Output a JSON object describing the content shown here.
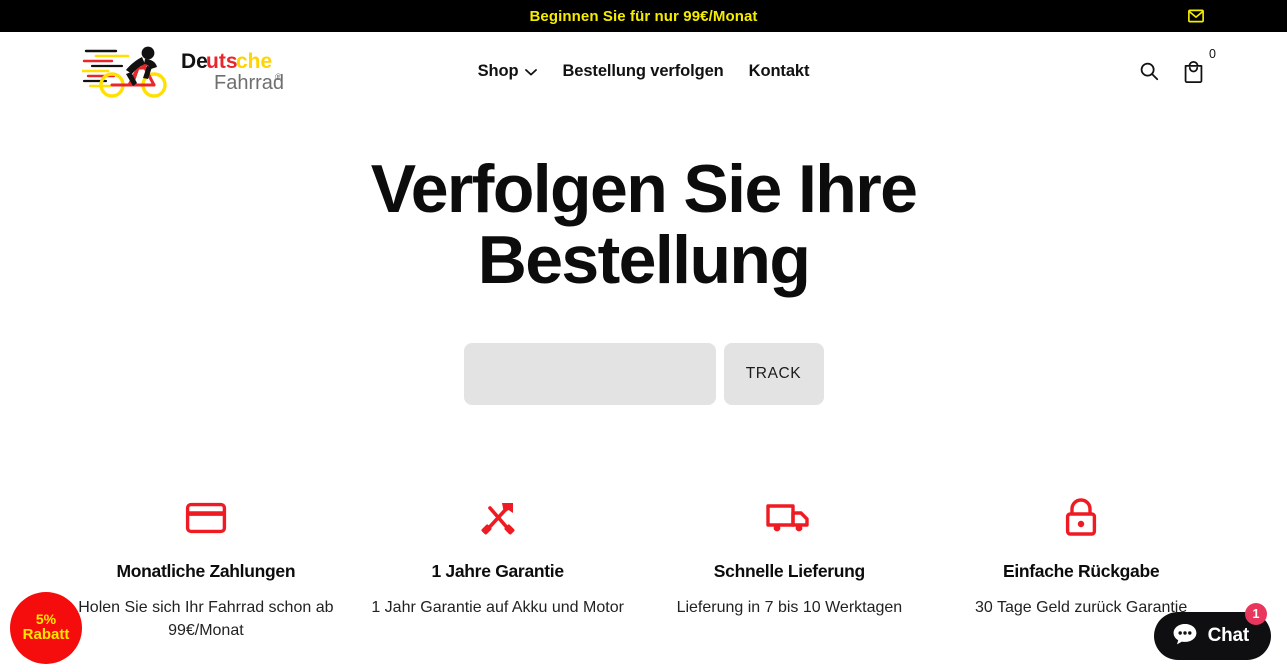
{
  "announcement": {
    "text": "Beginnen Sie für nur 99€/Monat",
    "mail_icon": "mail-icon",
    "text_color": "#f5ec00",
    "background": "#000000"
  },
  "header": {
    "logo": {
      "icon": "cyclist-icon",
      "word_primary": "Deutsche",
      "word_secondary": "Fahrrad",
      "trademark": "®",
      "colors": {
        "black": "#111111",
        "red": "#e8262c",
        "yellow": "#ffe000",
        "gray": "#6f6f6f"
      }
    },
    "nav": [
      {
        "label": "Shop",
        "has_dropdown": true,
        "icon": "chevron-down-icon"
      },
      {
        "label": "Bestellung verfolgen",
        "has_dropdown": false
      },
      {
        "label": "Kontakt",
        "has_dropdown": false
      }
    ],
    "actions": {
      "search_icon": "search-icon",
      "cart_icon": "shopping-bag-icon",
      "cart_count": "0"
    }
  },
  "hero": {
    "title_line1": "Verfolgen Sie Ihre",
    "title_line2": "Bestellung"
  },
  "track_form": {
    "input_value": "",
    "input_placeholder": "",
    "button_label": "TRACK",
    "field_background": "#e3e3e3"
  },
  "features": [
    {
      "icon": "credit-card-icon",
      "title": "Monatliche Zahlungen",
      "description": "Holen Sie sich Ihr Fahrrad schon ab 99€/Monat"
    },
    {
      "icon": "tools-icon",
      "title": "1 Jahre Garantie",
      "description": "1 Jahr Garantie auf Akku und Motor"
    },
    {
      "icon": "delivery-truck-icon",
      "title": "Schnelle Lieferung",
      "description": "Lieferung in 7 bis 10 Werktagen"
    },
    {
      "icon": "lock-icon",
      "title": "Einfache Rückgabe",
      "description": "30 Tage Geld zurück Garantie"
    }
  ],
  "feature_icon_color": "#ee1b22",
  "discount_badge": {
    "percent": "5%",
    "label": "Rabatt",
    "background": "#f50d0d",
    "text_color": "#ffe800"
  },
  "chat_widget": {
    "label": "Chat",
    "badge_count": "1",
    "icon": "chat-bubble-icon",
    "background": "#0f0f12",
    "badge_color": "#e8365d"
  }
}
